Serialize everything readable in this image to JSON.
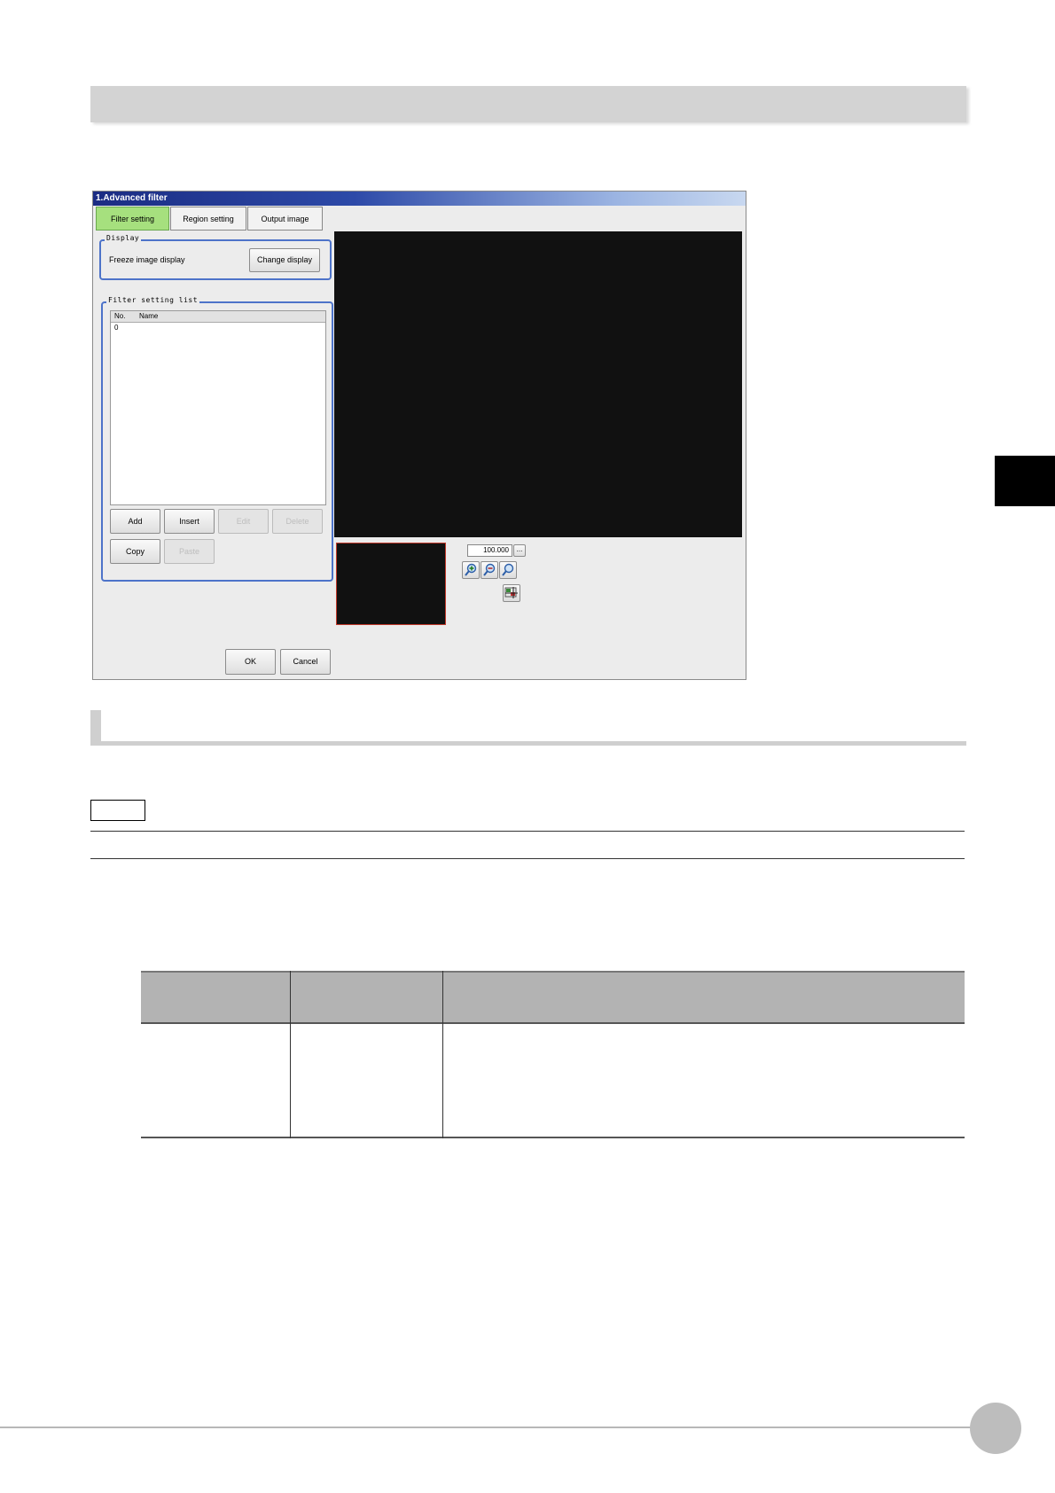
{
  "window": {
    "title": "1.Advanced filter",
    "tabs": [
      {
        "label": "Filter setting",
        "active": true
      },
      {
        "label": "Region setting",
        "active": false
      },
      {
        "label": "Output image",
        "active": false
      }
    ],
    "display_group": {
      "legend": "Display",
      "status_text": "Freeze image display",
      "change_display_label": "Change display"
    },
    "filter_list_group": {
      "legend": "Filter setting list",
      "columns": [
        "No.",
        "Name"
      ],
      "rows": [
        {
          "no": "0",
          "name": ""
        }
      ],
      "buttons": {
        "add": "Add",
        "insert": "Insert",
        "edit": "Edit",
        "delete": "Delete",
        "copy": "Copy",
        "paste": "Paste"
      }
    },
    "zoom": {
      "value": "100.000",
      "more_label": "..."
    },
    "footer": {
      "ok_label": "OK",
      "cancel_label": "Cancel"
    }
  },
  "colors": {
    "active_tab": "#a6e07e",
    "title_bar": "#1b2c83",
    "image_bg": "#111111",
    "group_border": "#4d73c9"
  },
  "icons": [
    "zoom-in-icon",
    "zoom-out-icon",
    "zoom-fit-icon",
    "display-settings-icon"
  ]
}
